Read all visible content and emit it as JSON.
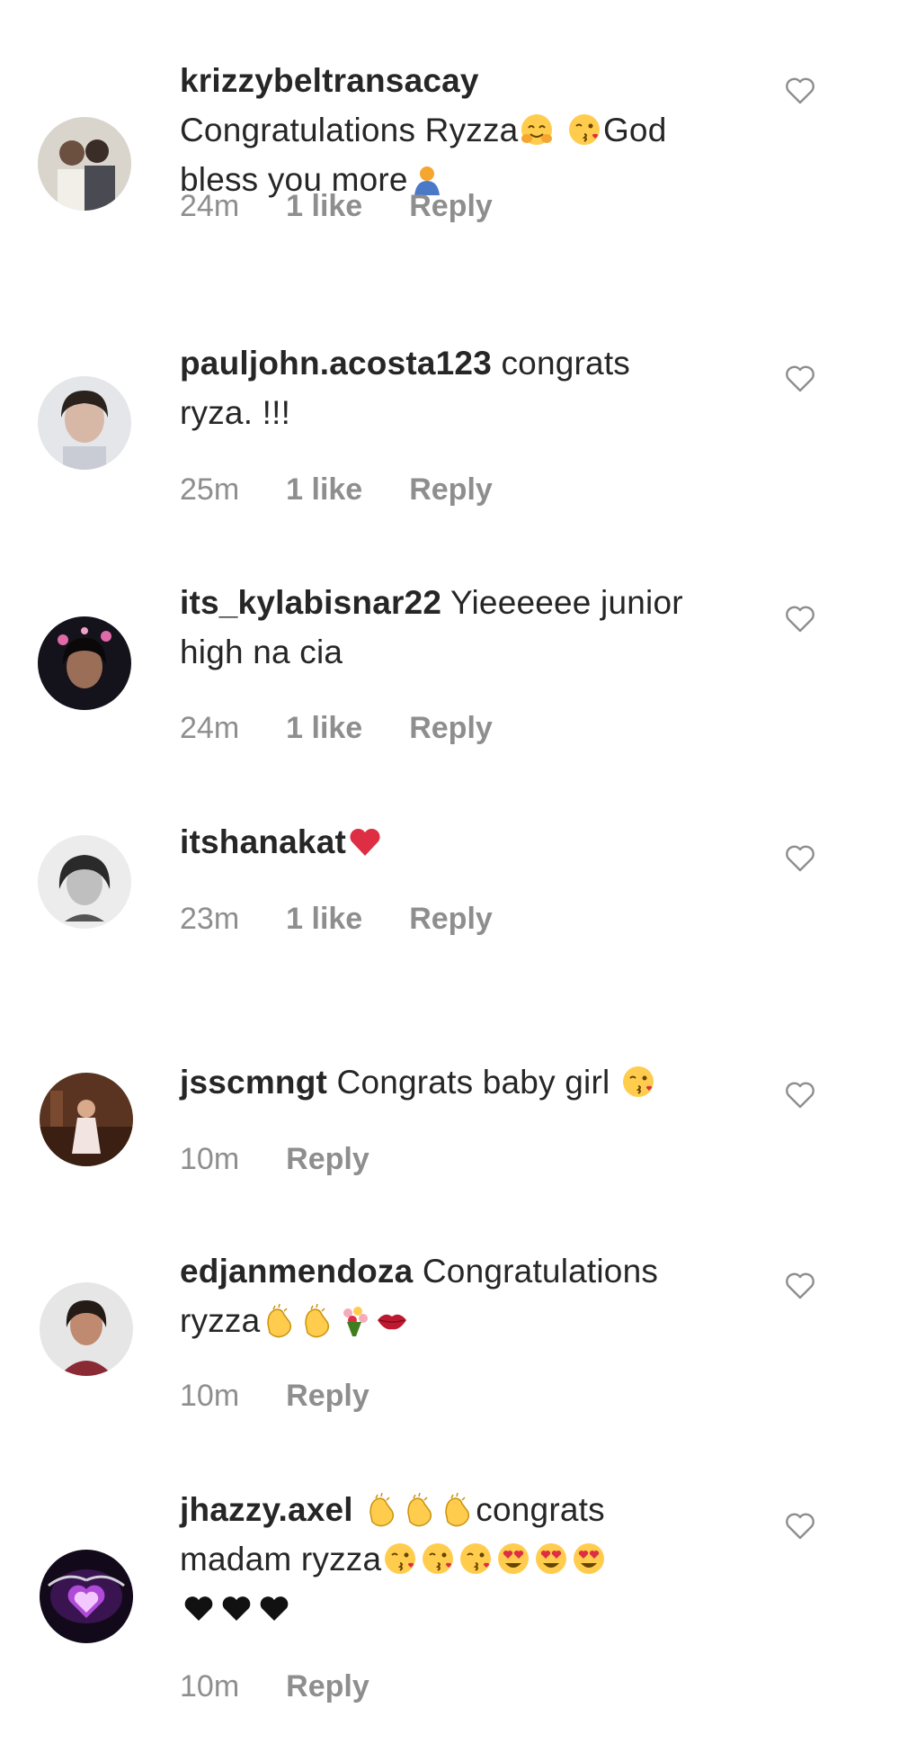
{
  "comments": [
    {
      "username": "krizzybeltransacay",
      "text_parts": [
        "Congratulations Ryzza",
        "",
        "",
        "God",
        "bless you more",
        ""
      ],
      "time": "24m",
      "likes": "1 like",
      "reply": "Reply"
    },
    {
      "username": "pauljohn.acosta123",
      "text": "congrats",
      "text2": "ryza. !!!",
      "time": "25m",
      "likes": "1 like",
      "reply": "Reply"
    },
    {
      "username": "its_kylabisnar22",
      "text": "Yieeeeee junior",
      "text2": "high na cia",
      "time": "24m",
      "likes": "1 like",
      "reply": "Reply"
    },
    {
      "username": "itshanakat",
      "time": "23m",
      "likes": "1 like",
      "reply": "Reply"
    },
    {
      "username": "jsscmngt",
      "text": "Congrats baby girl",
      "time": "10m",
      "reply": "Reply"
    },
    {
      "username": "edjanmendoza",
      "text": "Congratulations",
      "text2": "ryzza",
      "time": "10m",
      "reply": "Reply"
    },
    {
      "username": "jhazzy.axel",
      "text": "congrats",
      "text2": "madam ryzza",
      "time": "10m",
      "reply": "Reply"
    }
  ],
  "icons": {
    "like": "heart-outline-icon",
    "hug": "hugging-face-emoji",
    "kiss": "face-blowing-kiss-emoji",
    "pray": "person-bowing-emoji",
    "heart": "red-heart-emoji",
    "clap": "clapping-hands-emoji",
    "bouquet": "bouquet-emoji",
    "lips": "lips-emoji",
    "hearteyes": "heart-eyes-emoji",
    "blackheart": "black-heart-emoji"
  },
  "colors": {
    "text": "#262626",
    "meta": "#8e8e8e",
    "heart_outline": "#8e8e8e"
  }
}
